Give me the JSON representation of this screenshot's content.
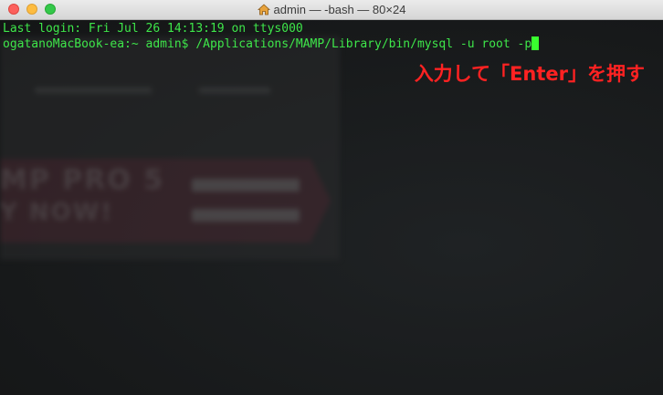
{
  "window": {
    "title": "admin — -bash — 80×24",
    "title_icon": "home-icon"
  },
  "terminal": {
    "line1": "Last login: Fri Jul 26 14:13:19 on ttys000",
    "line2_prompt": "ogatanoMacBook-ea:~ admin$ ",
    "line2_command": "/Applications/MAMP/Library/bin/mysql -u root -p",
    "text_color": "#3ee64a",
    "cursor_color": "#39ff2f"
  },
  "annotation": {
    "text": "入力して「Enter」を押す",
    "color": "#ff2222"
  }
}
